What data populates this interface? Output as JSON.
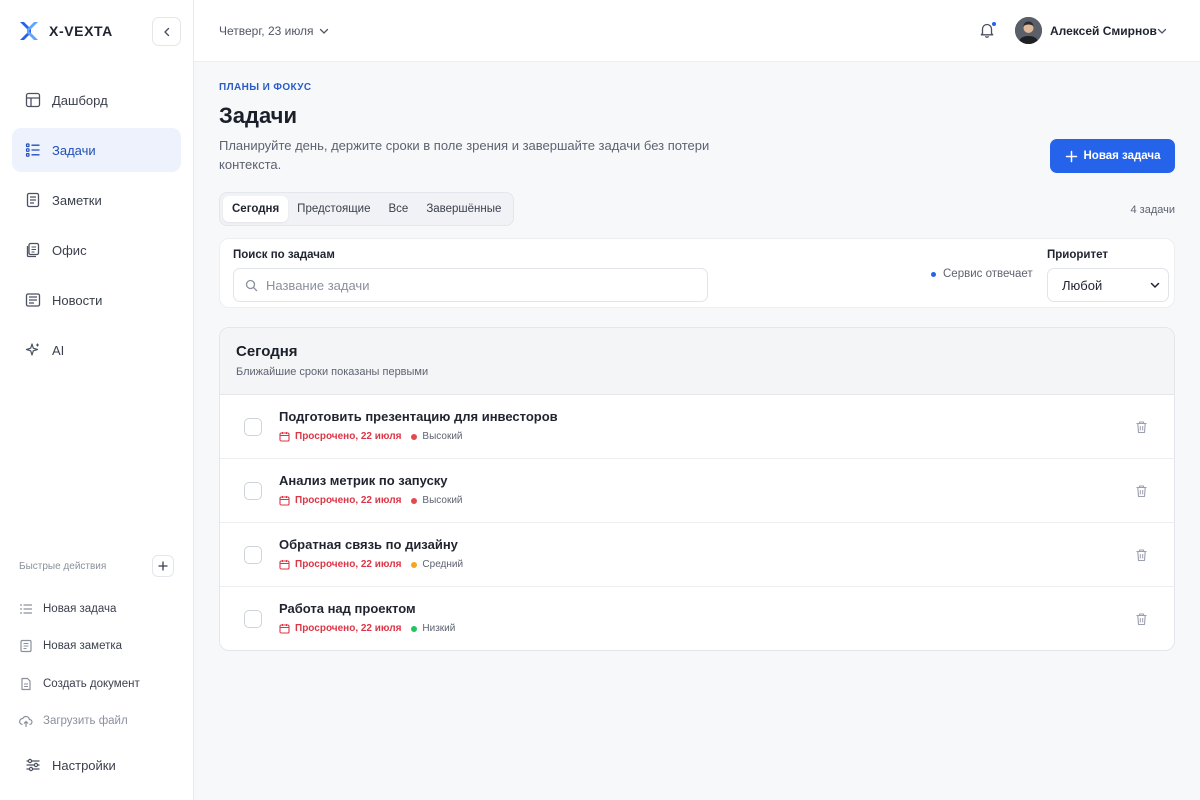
{
  "brand": {
    "name": "X-VEXTA"
  },
  "sidebar": {
    "items": [
      {
        "label": "Дашборд",
        "icon": "dashboard-icon",
        "active": false
      },
      {
        "label": "Задачи",
        "icon": "tasks-icon",
        "active": true
      },
      {
        "label": "Заметки",
        "icon": "notes-icon",
        "active": false
      },
      {
        "label": "Офис",
        "icon": "office-icon",
        "active": false
      },
      {
        "label": "Новости",
        "icon": "news-icon",
        "active": false
      },
      {
        "label": "AI",
        "icon": "sparkles-icon",
        "active": false
      }
    ],
    "quick_actions_title": "Быстрые действия",
    "quick_actions": [
      {
        "label": "Новая задача",
        "icon": "list-icon"
      },
      {
        "label": "Новая заметка",
        "icon": "note-icon"
      },
      {
        "label": "Создать документ",
        "icon": "document-icon"
      },
      {
        "label": "Загрузить файл",
        "icon": "upload-icon"
      }
    ],
    "settings_label": "Настройки"
  },
  "topbar": {
    "date": "Четверг, 23 июля",
    "user_name": "Алексей Смирнов"
  },
  "page": {
    "eyebrow": "ПЛАНЫ И ФОКУС",
    "title": "Задачи",
    "subtitle": "Планируйте день, держите сроки в поле зрения и завершайте задачи без потери контекста.",
    "new_task_label": "Новая задача",
    "tabs": [
      {
        "label": "Сегодня",
        "active": true
      },
      {
        "label": "Предстоящие",
        "active": false
      },
      {
        "label": "Все",
        "active": false
      },
      {
        "label": "Завершённые",
        "active": false
      }
    ],
    "count": "4 задачи"
  },
  "filters": {
    "search_label": "Поиск по задачам",
    "search_placeholder": "Название задачи",
    "search_value": "",
    "status_text": "Сервис отвечает",
    "priority_label": "Приоритет",
    "priority_value": "Любой"
  },
  "list": {
    "title": "Сегодня",
    "subtitle": "Ближайшие сроки показаны первыми",
    "tasks": [
      {
        "title": "Подготовить презентацию для инвесторов",
        "due": "Просрочено, 22 июля",
        "priority": "Высокий",
        "priority_color": "#e5484d",
        "done": false
      },
      {
        "title": "Анализ метрик по запуску",
        "due": "Просрочено, 22 июля",
        "priority": "Высокий",
        "priority_color": "#e5484d",
        "done": false
      },
      {
        "title": "Обратная связь по дизайну",
        "due": "Просрочено, 22 июля",
        "priority": "Средний",
        "priority_color": "#f5a524",
        "done": false
      },
      {
        "title": "Работа над проектом",
        "due": "Просрочено, 22 июля",
        "priority": "Низкий",
        "priority_color": "#22c55e",
        "done": false
      }
    ]
  },
  "colors": {
    "accent": "#2563eb",
    "overdue": "#dc3545",
    "active_nav_bg": "#eef2fc"
  }
}
